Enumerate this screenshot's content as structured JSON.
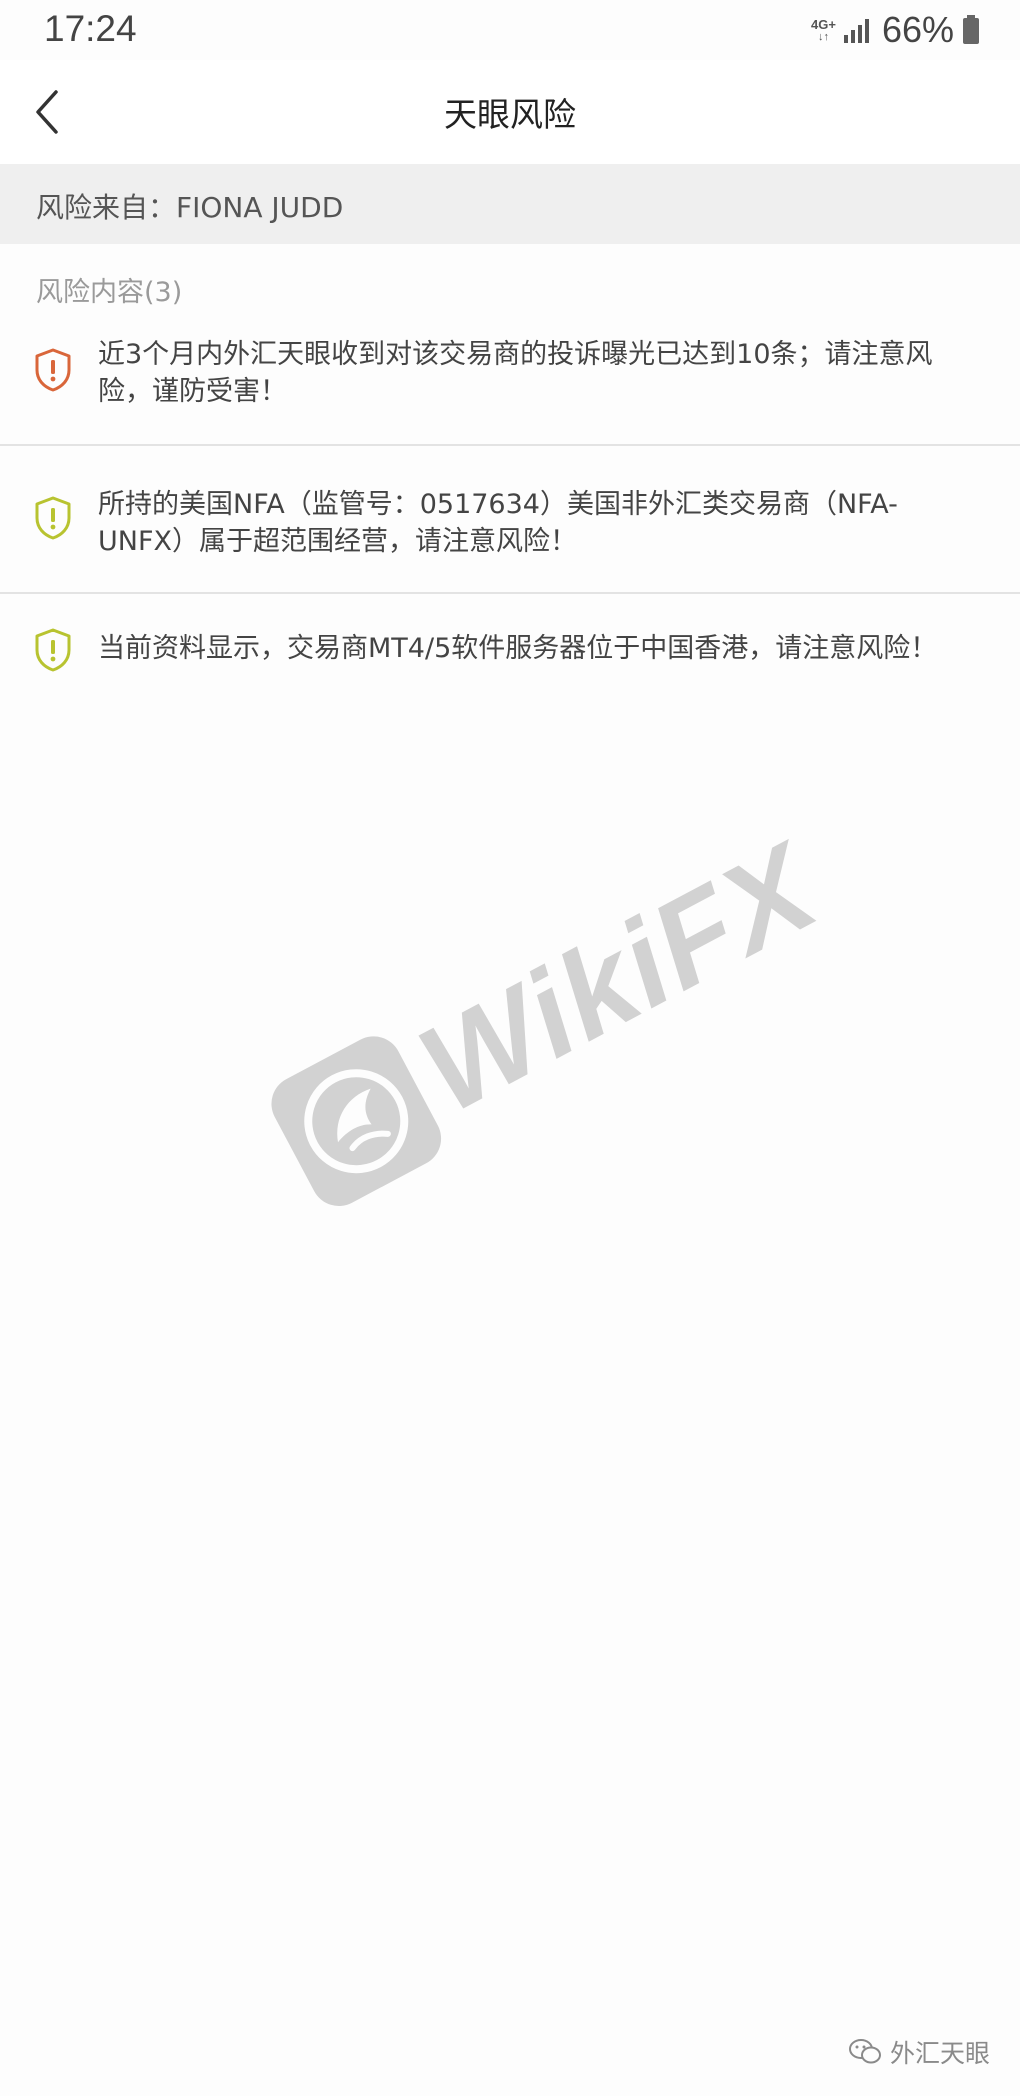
{
  "status_bar": {
    "time": "17:24",
    "network": "4G+",
    "network_arrows": "↓↑",
    "battery": "66%"
  },
  "nav": {
    "title": "天眼风险",
    "back_icon": "chevron-left-icon"
  },
  "source": {
    "text": "风险来自：FIONA JUDD"
  },
  "section": {
    "label": "风险内容(3)"
  },
  "risks": [
    {
      "level": "high",
      "icon": "shield-alert-icon",
      "color": "#d9663a",
      "text": "近3个月内外汇天眼收到对该交易商的投诉曝光已达到10条；请注意风险，谨防受害！"
    },
    {
      "level": "medium",
      "icon": "shield-alert-icon",
      "color": "#b8c330",
      "text": "所持的美国NFA（监管号：0517634）美国非外汇类交易商（NFA-UNFX）属于超范围经营，请注意风险！"
    },
    {
      "level": "medium",
      "icon": "shield-alert-icon",
      "color": "#b8c330",
      "text": "当前资料显示，交易商MT4/5软件服务器位于中国香港，请注意风险！"
    }
  ],
  "watermark": {
    "text": "WikiFX"
  },
  "footer_badge": {
    "label": "外汇天眼"
  }
}
